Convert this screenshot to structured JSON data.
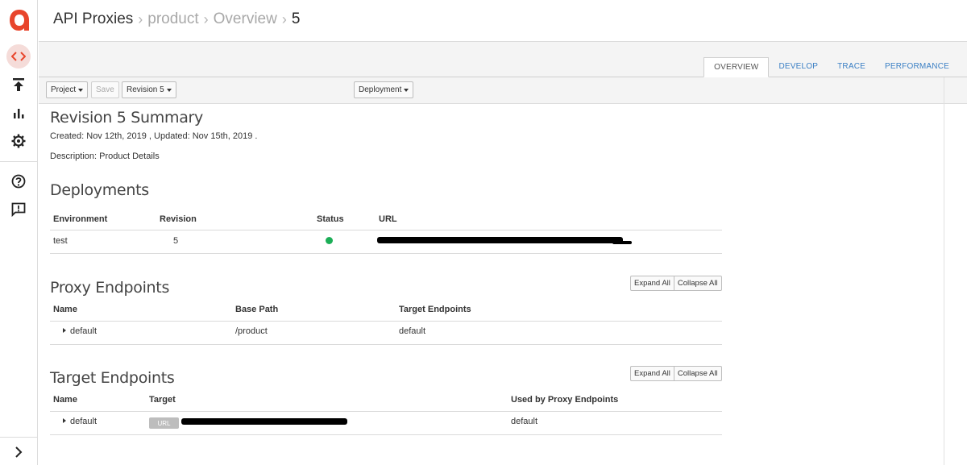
{
  "header": {
    "breadcrumb": [
      {
        "label": "API Proxies"
      },
      {
        "label": "product"
      },
      {
        "label": "Overview"
      },
      {
        "label": "5"
      }
    ]
  },
  "sidebar": {
    "items": [
      {
        "icon": "code-brackets-icon",
        "active": true
      },
      {
        "icon": "upload-icon"
      },
      {
        "icon": "bar-chart-icon"
      },
      {
        "icon": "gear-icon"
      },
      {
        "icon": "help-icon"
      },
      {
        "icon": "feedback-icon"
      }
    ],
    "expand_icon": "chevron-right-icon"
  },
  "tabs": [
    {
      "label": "OVERVIEW",
      "active": true
    },
    {
      "label": "DEVELOP"
    },
    {
      "label": "TRACE"
    },
    {
      "label": "PERFORMANCE"
    }
  ],
  "toolbar": {
    "project_label": "Project",
    "save_label": "Save",
    "revision_label": "Revision 5",
    "deployment_label": "Deployment"
  },
  "summary": {
    "title": "Revision 5 Summary",
    "created": "Created: Nov 12th, 2019 , Updated: Nov 15th, 2019 .",
    "description": "Description: Product Details"
  },
  "deployments": {
    "title": "Deployments",
    "columns": [
      "Environment",
      "Revision",
      "Status",
      "URL"
    ],
    "rows": [
      {
        "environment": "test",
        "revision": "5",
        "status": "deployed"
      }
    ]
  },
  "proxy_endpoints": {
    "title": "Proxy Endpoints",
    "expand_all": "Expand All",
    "collapse_all": "Collapse All",
    "columns": [
      "Name",
      "Base Path",
      "Target Endpoints"
    ],
    "rows": [
      {
        "name": "default",
        "base_path": "/product",
        "target_endpoints": "default"
      }
    ]
  },
  "target_endpoints": {
    "title": "Target Endpoints",
    "expand_all": "Expand All",
    "collapse_all": "Collapse All",
    "columns": [
      "Name",
      "Target",
      "Used by Proxy Endpoints"
    ],
    "rows": [
      {
        "name": "default",
        "target_badge": "URL",
        "used_by": "default"
      }
    ]
  },
  "colors": {
    "accent": "#e8452c",
    "link": "#3a7fc4",
    "status_ok": "#1cae57"
  }
}
